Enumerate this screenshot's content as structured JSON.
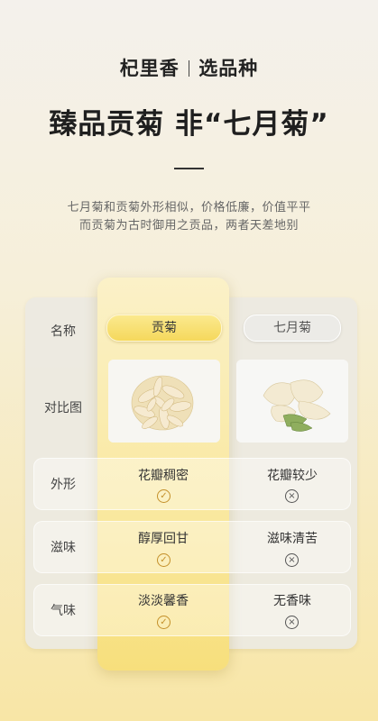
{
  "header": {
    "brand": "杞里香",
    "subtitle": "选品种",
    "title": "臻品贡菊 非“七月菊”",
    "description_line1": "七月菊和贡菊外形相似，价格低廉，价值平平",
    "description_line2": "而贡菊为古时御用之贡品，两者天差地别"
  },
  "table": {
    "row_labels": [
      "名称",
      "对比图",
      "外形",
      "滋味",
      "气味"
    ],
    "columns": [
      {
        "name": "贡菊",
        "values": [
          "花瓣稠密",
          "醇厚回甘",
          "淡淡馨香"
        ],
        "status_icon": "check-icon"
      },
      {
        "name": "七月菊",
        "values": [
          "花瓣较少",
          "滋味清苦",
          "无香味"
        ],
        "status_icon": "cross-icon"
      }
    ]
  },
  "colors": {
    "highlight": "#f9e89f",
    "check": "#c4902a",
    "cross": "#555555"
  }
}
